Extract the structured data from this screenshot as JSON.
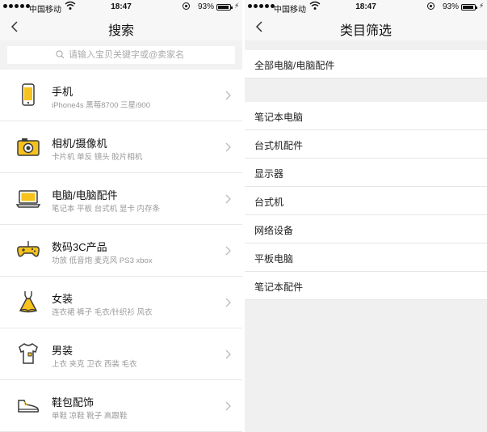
{
  "left": {
    "status": {
      "carrier": "中国移动",
      "time": "18:47",
      "battery_pct": "93%"
    },
    "nav": {
      "title": "搜索"
    },
    "search": {
      "placeholder": "请输入宝贝关键字或@卖家名"
    },
    "categories": [
      {
        "name": "手机",
        "desc": "iPhone4s 黑莓8700 三星i900",
        "icon": "phone-icon"
      },
      {
        "name": "相机/摄像机",
        "desc": "卡片机 单反 镜头 胶片相机",
        "icon": "camera-icon"
      },
      {
        "name": "电脑/电脑配件",
        "desc": "笔记本 平板 台式机 显卡 内存条",
        "icon": "laptop-icon"
      },
      {
        "name": "数码3C产品",
        "desc": "功放 低音炮 麦克风 PS3 xbox",
        "icon": "gamepad-icon"
      },
      {
        "name": "女装",
        "desc": "连衣裙 裤子 毛衣/针织衫 风衣",
        "icon": "dress-icon"
      },
      {
        "name": "男装",
        "desc": "上衣 夹克 卫衣 西装 毛衣",
        "icon": "tshirt-icon"
      },
      {
        "name": "鞋包配饰",
        "desc": "单鞋 凉鞋 靴子 高跟鞋",
        "icon": "shoe-icon"
      }
    ]
  },
  "right": {
    "status": {
      "carrier": "中国移动",
      "time": "18:47",
      "battery_pct": "93%"
    },
    "nav": {
      "title": "类目筛选"
    },
    "all_item": "全部电脑/电脑配件",
    "items": [
      "笔记本电脑",
      "台式机配件",
      "显示器",
      "台式机",
      "网络设备",
      "平板电脑",
      "笔记本配件"
    ]
  },
  "colors": {
    "icon_accent": "#f7c21b",
    "icon_stroke": "#3a3a3a",
    "divider": "#e8e8e8"
  }
}
